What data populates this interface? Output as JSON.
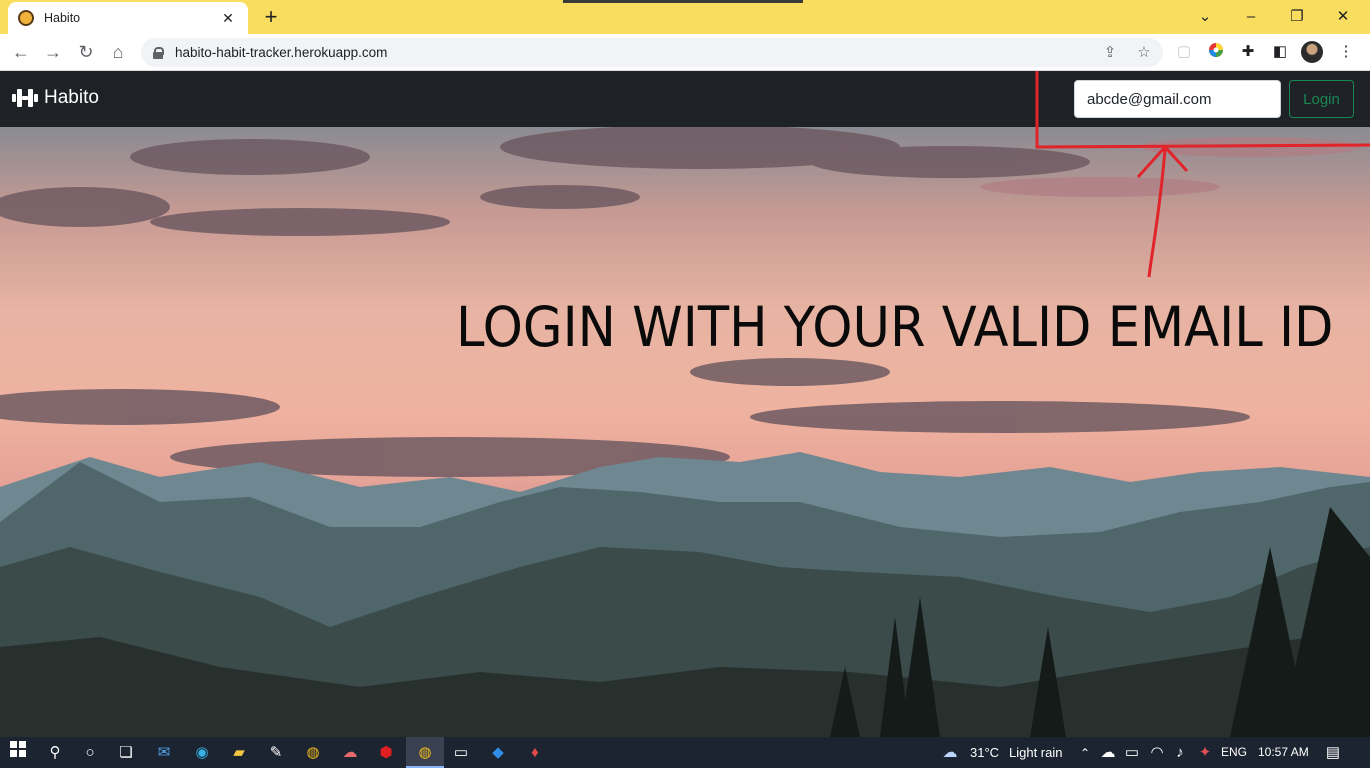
{
  "browser": {
    "tab_title": "Habito",
    "url": "habito-habit-tracker.herokuapp.com",
    "new_tab_icon": "+",
    "close_tab_icon": "✕"
  },
  "navbar": {
    "brand": "Habito",
    "email_value": "abcde@gmail.com",
    "login_label": "Login"
  },
  "hero": {
    "headline": "LOGIN WITH YOUR VALID EMAIL ID"
  },
  "taskbar": {
    "temperature": "31°C",
    "weather": "Light rain",
    "language": "ENG",
    "time": "10:57 AM"
  },
  "colors": {
    "tab_strip": "#f9dd5f",
    "navbar": "#1e2125",
    "login_accent": "#198754",
    "annotation": "#e0242a",
    "taskbar": "#1c2331"
  }
}
